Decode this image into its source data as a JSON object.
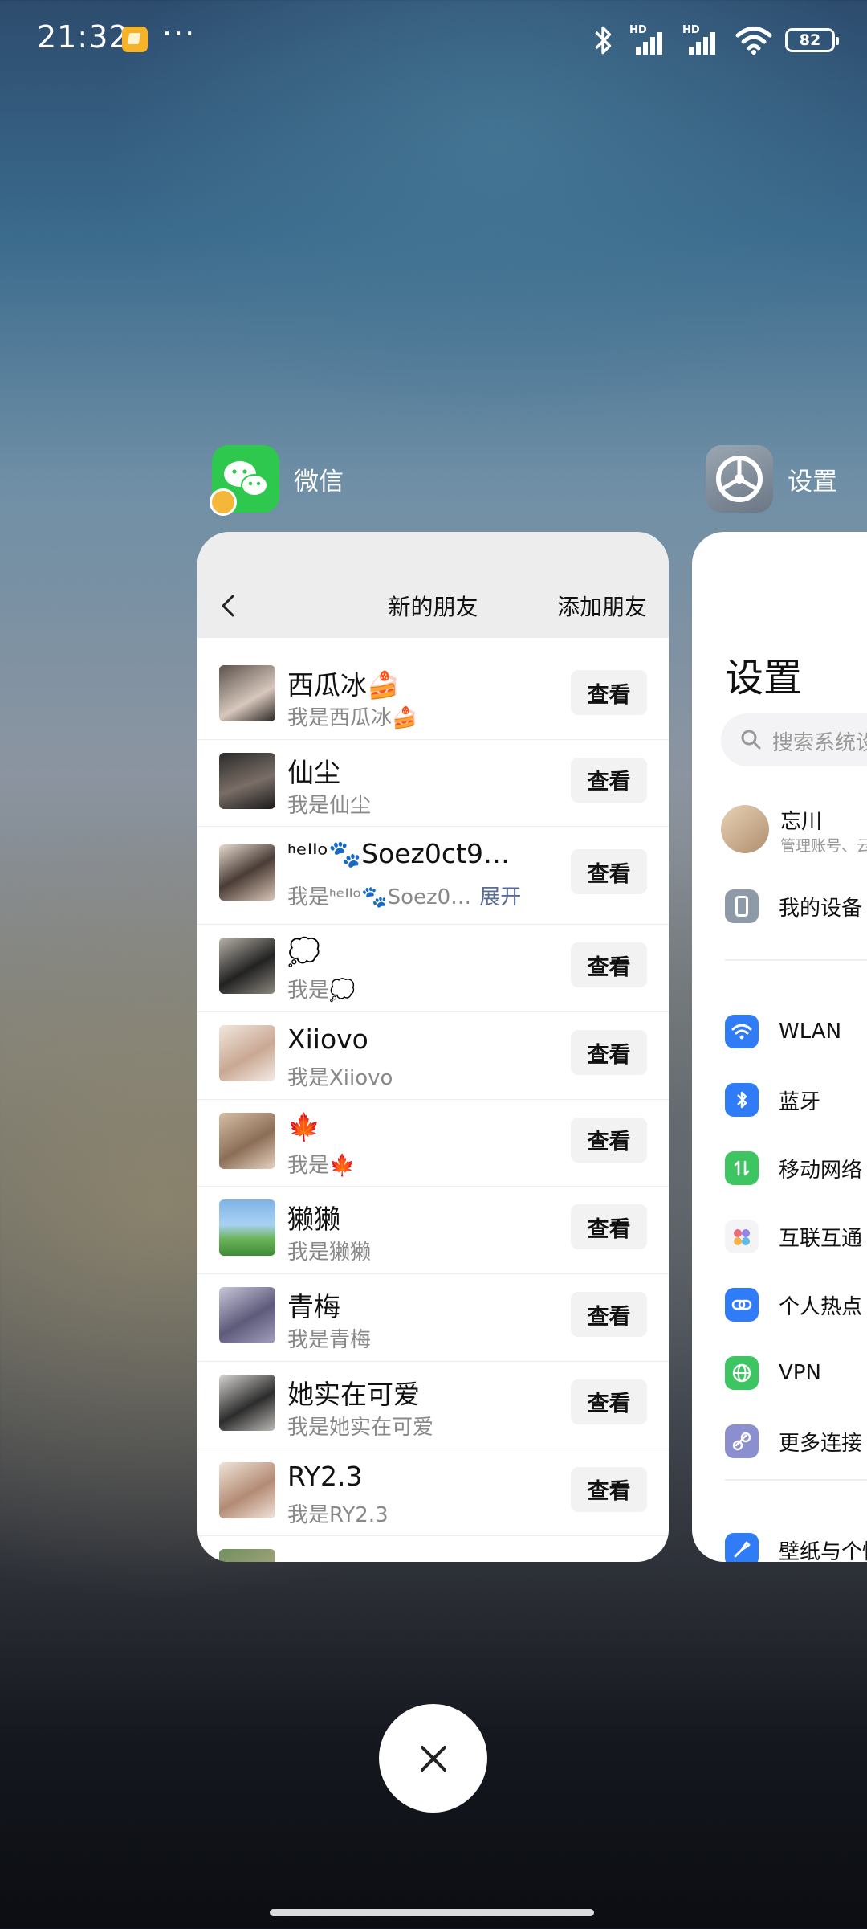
{
  "status_bar": {
    "time": "21:32",
    "more": "···",
    "network_hd_1": "HD",
    "network_hd_2": "HD",
    "battery": "82"
  },
  "apps": {
    "wechat": {
      "name": "微信",
      "header": {
        "back_icon": "chevron-left-icon",
        "title": "新的朋友",
        "action": "添加朋友"
      },
      "requests": [
        {
          "name": "西瓜冰🍰",
          "message": "我是西瓜冰🍰",
          "button": "查看",
          "expand": ""
        },
        {
          "name": "仙尘",
          "message": "我是仙尘",
          "button": "查看",
          "expand": ""
        },
        {
          "name": "ᑋᵉᑊᑊᵒ🐾Soez0ct9…",
          "message": "我是ᑋᵉᑊᑊᵒ🐾Soez0…",
          "button": "查看",
          "expand": "展开"
        },
        {
          "name": "💭",
          "message": "我是💭",
          "button": "查看",
          "expand": ""
        },
        {
          "name": "Xiiovo",
          "message": "我是Xiiovo",
          "button": "查看",
          "expand": ""
        },
        {
          "name": "🍁",
          "message": "我是🍁",
          "button": "查看",
          "expand": ""
        },
        {
          "name": "獭獭",
          "message": "我是獭獭",
          "button": "查看",
          "expand": ""
        },
        {
          "name": "青梅",
          "message": "我是青梅",
          "button": "查看",
          "expand": ""
        },
        {
          "name": "她实在可爱",
          "message": "我是她实在可爱",
          "button": "查看",
          "expand": ""
        },
        {
          "name": "RY2.3",
          "message": "我是RY2.3",
          "button": "查看",
          "expand": ""
        }
      ]
    },
    "settings": {
      "name": "设置",
      "title": "设置",
      "search_placeholder": "搜索系统设",
      "profile": {
        "name": "忘川",
        "sub": "管理账号、云"
      },
      "items": [
        {
          "label": "我的设备",
          "icon": "phone-icon",
          "color": "#8e9aa8"
        },
        {
          "label": "WLAN",
          "icon": "wifi-icon",
          "color": "#2f7cf6"
        },
        {
          "label": "蓝牙",
          "icon": "bluetooth-icon",
          "color": "#2f7cf6"
        },
        {
          "label": "移动网络",
          "icon": "mobile-data-icon",
          "color": "#3cc561"
        },
        {
          "label": "互联互通",
          "icon": "interconnect-icon",
          "color": "#f4f4f6"
        },
        {
          "label": "个人热点",
          "icon": "hotspot-link-icon",
          "color": "#2f7cf6"
        },
        {
          "label": "VPN",
          "icon": "globe-icon",
          "color": "#3cc561"
        },
        {
          "label": "更多连接",
          "icon": "more-connections-icon",
          "color": "#8b8fd0"
        },
        {
          "label": "壁纸与个性",
          "icon": "wallpaper-icon",
          "color": "#2f7cf6"
        }
      ]
    }
  }
}
